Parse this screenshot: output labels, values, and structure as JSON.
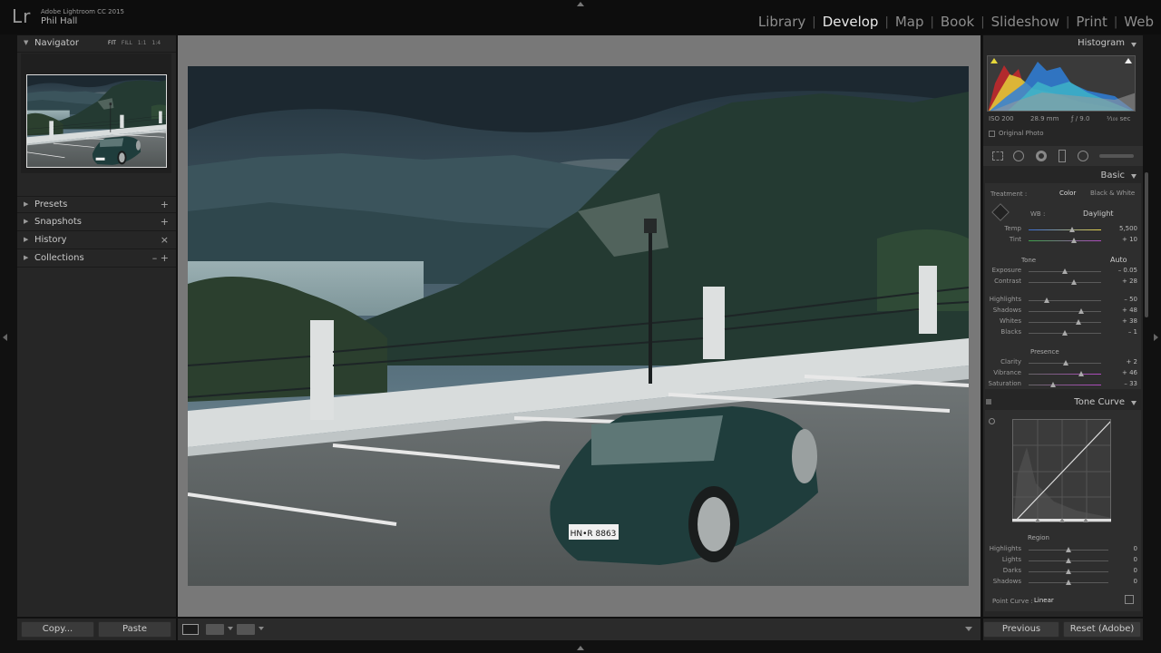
{
  "app": {
    "logo": "Lr",
    "name": "Adobe Lightroom CC 2015",
    "user": "Phil Hall"
  },
  "modules": [
    {
      "label": "Library",
      "active": false
    },
    {
      "label": "Develop",
      "active": true
    },
    {
      "label": "Map",
      "active": false
    },
    {
      "label": "Book",
      "active": false
    },
    {
      "label": "Slideshow",
      "active": false
    },
    {
      "label": "Print",
      "active": false
    },
    {
      "label": "Web",
      "active": false
    }
  ],
  "left": {
    "navigator": {
      "title": "Navigator",
      "zoom": [
        "FIT",
        "FILL",
        "1:1",
        "1:4"
      ]
    },
    "panels": [
      {
        "title": "Presets",
        "action": "+"
      },
      {
        "title": "Snapshots",
        "action": "+"
      },
      {
        "title": "History",
        "action": "×"
      },
      {
        "title": "Collections",
        "action": "– +"
      }
    ],
    "copy_label": "Copy...",
    "paste_label": "Paste"
  },
  "histogram": {
    "title": "Histogram",
    "iso": "ISO 200",
    "focal": "28.9 mm",
    "aperture": "ƒ / 9.0",
    "shutter": "¹⁄₁₀₀ sec",
    "original": "Original Photo"
  },
  "basic": {
    "title": "Basic",
    "treatment_label": "Treatment :",
    "treatment_color": "Color",
    "treatment_bw": "Black & White",
    "wb_label": "WB :",
    "wb_value": "Daylight",
    "tone_label": "Tone",
    "auto_label": "Auto",
    "presence_label": "Presence",
    "sliders": [
      {
        "name": "Temp",
        "value": "5,500",
        "pos": 0.6,
        "group": "wb"
      },
      {
        "name": "Tint",
        "value": "+ 10",
        "pos": 0.62,
        "group": "wb"
      },
      {
        "name": "Exposure",
        "value": "– 0.05",
        "pos": 0.5,
        "group": "tone"
      },
      {
        "name": "Contrast",
        "value": "+ 28",
        "pos": 0.62,
        "group": "tone"
      },
      {
        "name": "Highlights",
        "value": "– 50",
        "pos": 0.25,
        "group": "tone2"
      },
      {
        "name": "Shadows",
        "value": "+ 48",
        "pos": 0.73,
        "group": "tone2"
      },
      {
        "name": "Whites",
        "value": "+ 38",
        "pos": 0.69,
        "group": "tone2"
      },
      {
        "name": "Blacks",
        "value": "– 1",
        "pos": 0.5,
        "group": "tone2"
      },
      {
        "name": "Clarity",
        "value": "+ 2",
        "pos": 0.51,
        "group": "presence"
      },
      {
        "name": "Vibrance",
        "value": "+ 46",
        "pos": 0.73,
        "group": "presence"
      },
      {
        "name": "Saturation",
        "value": "– 33",
        "pos": 0.34,
        "group": "presence"
      }
    ]
  },
  "tonecurve": {
    "title": "Tone Curve",
    "region_label": "Region",
    "regions": [
      {
        "name": "Highlights",
        "value": "0"
      },
      {
        "name": "Lights",
        "value": "0"
      },
      {
        "name": "Darks",
        "value": "0"
      },
      {
        "name": "Shadows",
        "value": "0"
      }
    ],
    "point_curve_label": "Point Curve :",
    "point_curve_value": "Linear"
  },
  "previous_label": "Previous",
  "reset_label": "Reset (Adobe)",
  "plate_text": "HN•R 8863"
}
